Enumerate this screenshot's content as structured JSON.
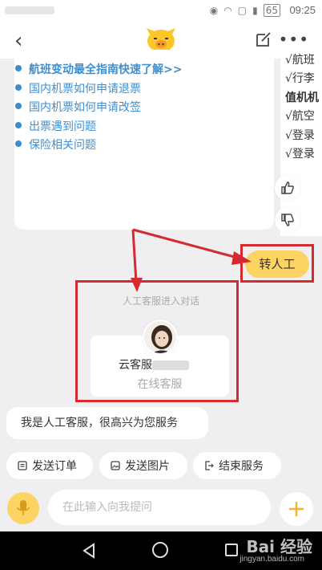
{
  "status_bar": {
    "time": "09:25",
    "battery": "65"
  },
  "nav": {
    "back_glyph": "‹",
    "more_glyph": "•••"
  },
  "faq": {
    "items": [
      {
        "label": "航班变动最全指南快速了解>>",
        "bold": true
      },
      {
        "label": "国内机票如何申请退票"
      },
      {
        "label": "国内机票如何申请改签"
      },
      {
        "label": "出票遇到问题"
      },
      {
        "label": "保险相关问题"
      }
    ]
  },
  "side_card": {
    "lines": [
      "√航班",
      "√行李",
      "值机机",
      "√航空",
      "√登录",
      "√登录"
    ]
  },
  "transfer_button": "转人工",
  "chat": {
    "joined_notice": "人工客服进入对话",
    "agent_name": "云客服",
    "agent_role": "在线客服",
    "agent_message": "我是人工客服，很高兴为您服务"
  },
  "quick_actions": [
    {
      "label": "发送订单",
      "icon": "order-icon"
    },
    {
      "label": "发送图片",
      "icon": "image-icon"
    },
    {
      "label": "结束服务",
      "icon": "exit-icon"
    }
  ],
  "input": {
    "placeholder": "在此输入向我提问"
  },
  "watermark": {
    "text": "Bai 经验",
    "sub": "jingyan.baidu.com"
  },
  "colors": {
    "accent": "#fdd364",
    "link": "#3f8fd0",
    "annotation": "#d42a30"
  }
}
